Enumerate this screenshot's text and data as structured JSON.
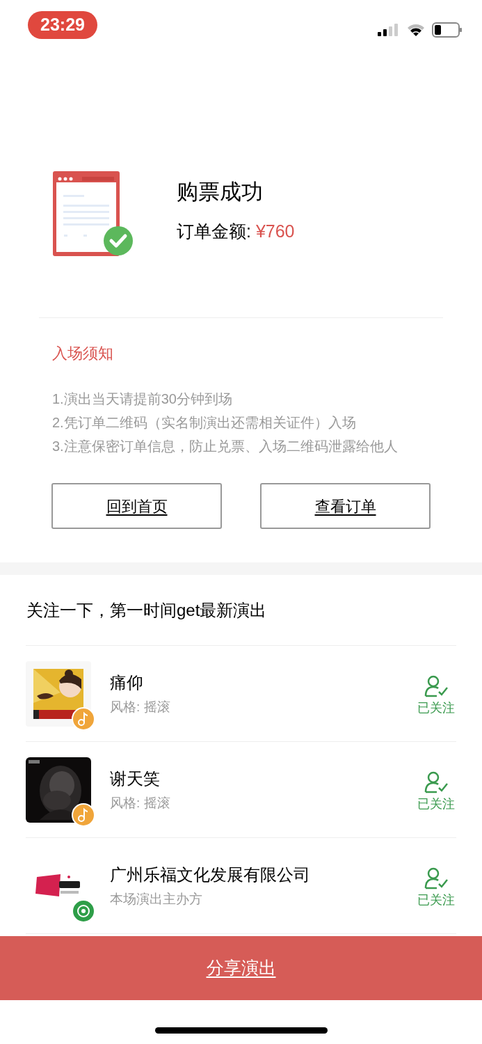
{
  "status_bar": {
    "time": "23:29"
  },
  "result": {
    "title": "购票成功",
    "amount_label": "订单金额: ",
    "amount": "¥760"
  },
  "notice": {
    "title": "入场须知",
    "lines": [
      "1.演出当天请提前30分钟到场",
      "2.凭订单二维码（实名制演出还需相关证件）入场",
      "3.注意保密订单信息，防止兑票、入场二维码泄露给他人"
    ]
  },
  "buttons": [
    "回到首页",
    "查看订单"
  ],
  "follow_section": {
    "title": "关注一下，第一时间get最新演出",
    "items": [
      {
        "name": "痛仰",
        "subtitle": "风格: 摇滚",
        "kind": "music",
        "followed": true,
        "follow_label": "已关注"
      },
      {
        "name": "谢天笑",
        "subtitle": "风格: 摇滚",
        "kind": "music",
        "followed": true,
        "follow_label": "已关注"
      },
      {
        "name": "广州乐福文化发展有限公司",
        "subtitle": "本场演出主办方",
        "kind": "organizer",
        "followed": true,
        "follow_label": "已关注"
      }
    ]
  },
  "share_button": "分享演出"
}
